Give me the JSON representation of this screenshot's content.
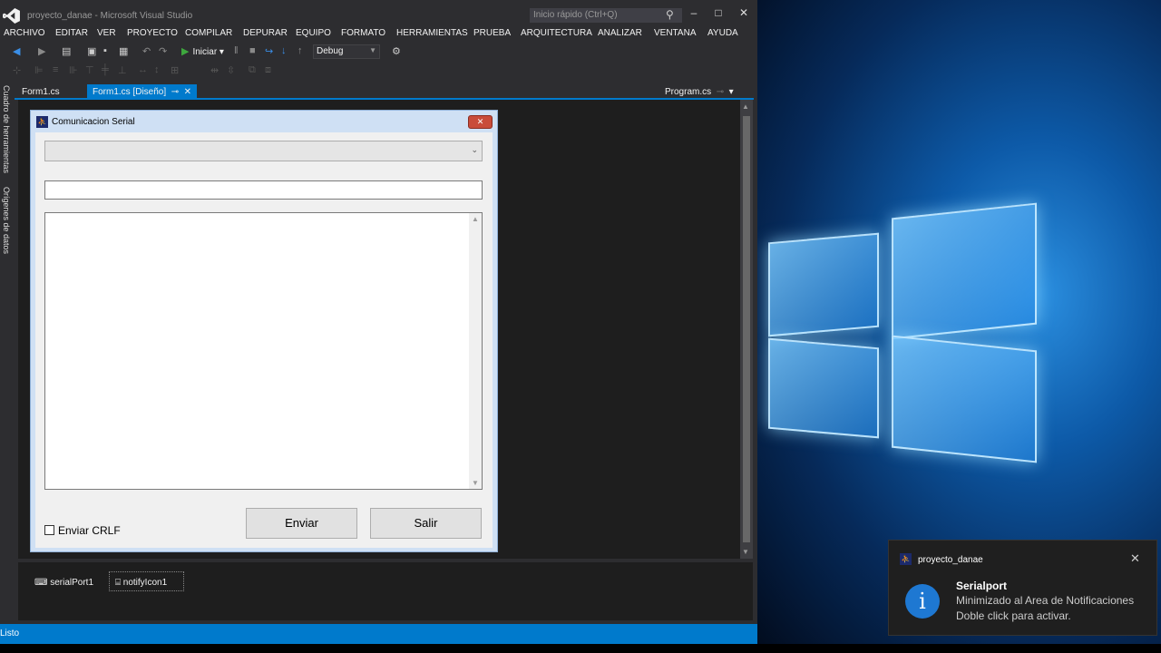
{
  "vs": {
    "title": "proyecto_danae - Microsoft Visual Studio",
    "quick_launch": "Inicio rápido (Ctrl+Q)",
    "menu": [
      "ARCHIVO",
      "EDITAR",
      "VER",
      "PROYECTO",
      "COMPILAR",
      "DEPURAR",
      "EQUIPO",
      "FORMATO",
      "HERRAMIENTAS",
      "PRUEBA",
      "ARQUITECTURA",
      "ANALIZAR",
      "VENTANA",
      "AYUDA"
    ],
    "run_label": "Iniciar",
    "config": "Debug",
    "side_panels": [
      "Cuadro de herramientas",
      "Orígenes de datos"
    ],
    "tabs": {
      "tab1": "Form1.cs",
      "tab2": "Form1.cs [Diseño]",
      "tab3": "Program.cs"
    },
    "status": "Listo",
    "tray": {
      "item1": "serialPort1",
      "item2": "notifyIcon1"
    }
  },
  "form": {
    "title": "Comunicacion Serial",
    "checkbox_label": "Enviar CRLF",
    "send_label": "Enviar",
    "exit_label": "Salir"
  },
  "toast": {
    "app": "proyecto_danae",
    "title": "Serialport",
    "line1": "Minimizado al Area de Notificaciones",
    "line2": "Doble click para activar."
  },
  "colors": {
    "accent": "#007acc",
    "vs_bg": "#2d2d30",
    "editor_bg": "#1e1e1e"
  }
}
